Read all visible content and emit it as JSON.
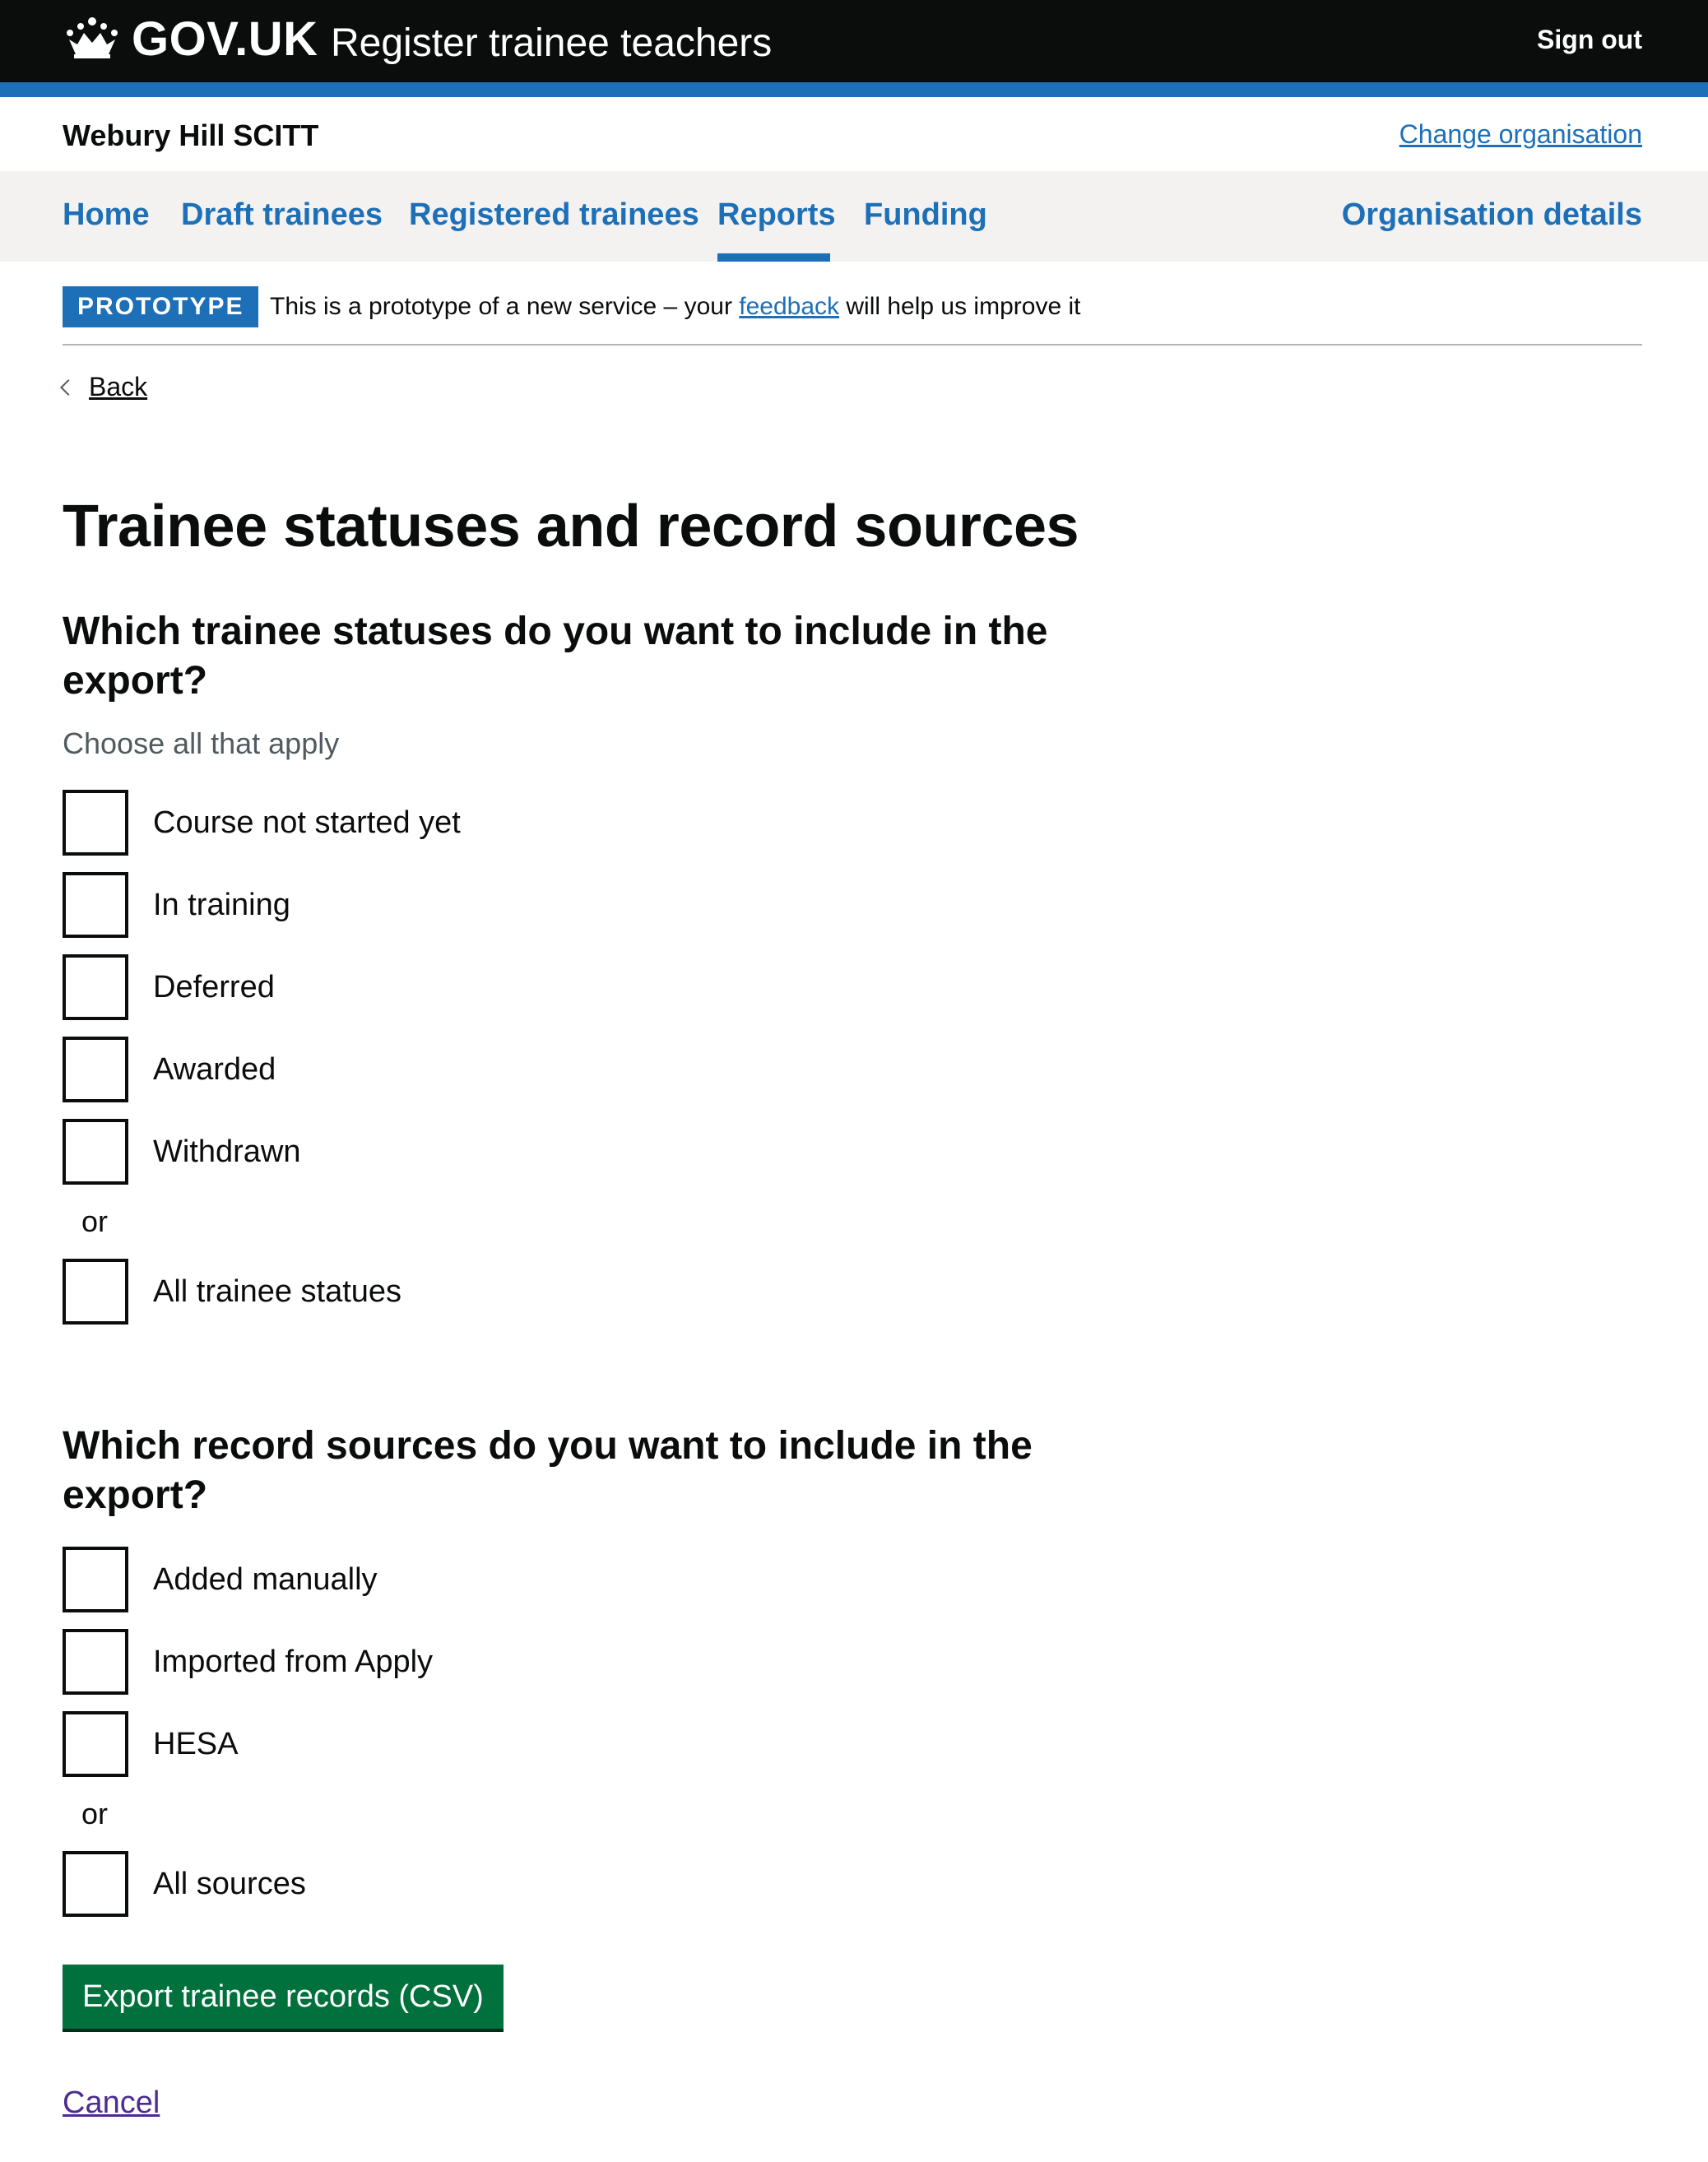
{
  "header": {
    "logotype": "GOV.UK",
    "service_name": "Register trainee teachers",
    "sign_out": "Sign out",
    "crown_icon": "crown-icon"
  },
  "org": {
    "name": "Webury Hill SCITT",
    "change": "Change organisation"
  },
  "nav": {
    "items": [
      {
        "label": "Home"
      },
      {
        "label": "Draft trainees"
      },
      {
        "label": "Registered trainees"
      },
      {
        "label": "Reports"
      },
      {
        "label": "Funding"
      }
    ],
    "active": "Reports",
    "right": "Organisation details"
  },
  "phase": {
    "tag": "PROTOTYPE",
    "text_before": "This is a prototype of a new service – your ",
    "link": "feedback",
    "text_after": " will help us improve it"
  },
  "back": "Back",
  "page_title": "Trainee statuses and record sources",
  "statuses": {
    "legend": "Which trainee statuses do you want to include in the export?",
    "hint": "Choose all that apply",
    "options": [
      "Course not started yet",
      "In training",
      "Deferred",
      "Awarded",
      "Withdrawn"
    ],
    "or": "or",
    "all": "All trainee statues"
  },
  "sources": {
    "legend": "Which record sources do you want to include in the export?",
    "options": [
      "Added manually",
      "Imported from Apply",
      "HESA"
    ],
    "or": "or",
    "all": "All sources"
  },
  "actions": {
    "export": "Export trainee records (CSV)",
    "cancel": "Cancel"
  },
  "colors": {
    "header_bg": "#0b0c0c",
    "brand_blue": "#1d70b8",
    "nav_bg": "#f3f2f1",
    "button_green": "#00703c",
    "visited_link": "#4c2c92"
  }
}
